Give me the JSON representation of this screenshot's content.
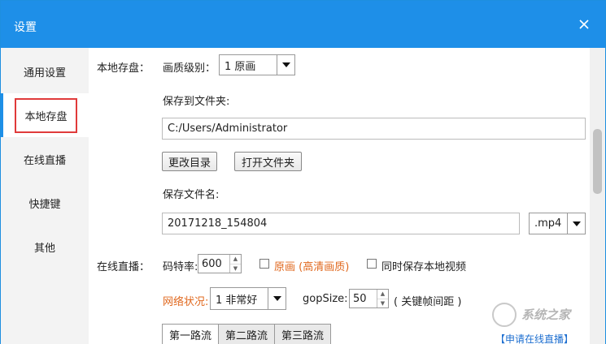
{
  "window": {
    "title": "设置"
  },
  "sidebar": {
    "items": [
      {
        "label": "通用设置"
      },
      {
        "label": "本地存盘"
      },
      {
        "label": "在线直播"
      },
      {
        "label": "快捷键"
      },
      {
        "label": "其他"
      }
    ],
    "active_index": 1
  },
  "local": {
    "section_label": "本地存盘：",
    "quality_label": "画质级别：",
    "quality_value": "1 原画",
    "save_folder_label": "保存到文件夹:",
    "save_folder_value": "C:/Users/Administrator",
    "change_dir_button": "更改目录",
    "open_folder_button": "打开文件夹",
    "filename_label": "保存文件名:",
    "filename_value": "20171218_154804",
    "extension_value": ".mp4"
  },
  "live": {
    "section_label": "在线直播：",
    "bitrate_label": "码特率:",
    "bitrate_value": "600",
    "original_checkbox_label": "原画 (高清画质)",
    "save_local_checkbox_label": "同时保存本地视频",
    "network_label": "网络状况:",
    "network_value": "1  非常好",
    "gopsize_label": "gopSize:",
    "gopsize_value": "50",
    "gopsize_hint": "( 关键帧间距 )",
    "streams": [
      {
        "label": "第一路流"
      },
      {
        "label": "第二路流"
      },
      {
        "label": "第三路流"
      }
    ],
    "apply_link": "【申请在线直播】"
  },
  "watermark": {
    "text": "系统之家"
  },
  "colors": {
    "accent": "#1e8fe8",
    "highlight": "#e03a3a",
    "orange": "#e0681e"
  }
}
